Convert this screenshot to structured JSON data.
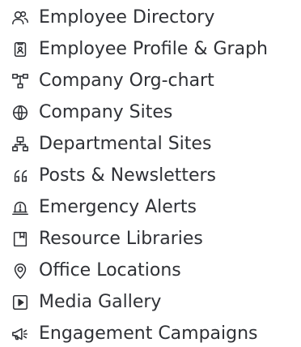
{
  "menu": {
    "items": [
      {
        "label": "Employee Directory",
        "icon": "people-icon"
      },
      {
        "label": "Employee Profile & Graph",
        "icon": "badge-icon"
      },
      {
        "label": "Company Org-chart",
        "icon": "org-chart-icon"
      },
      {
        "label": "Company Sites",
        "icon": "globe-icon"
      },
      {
        "label": "Departmental Sites",
        "icon": "network-icon"
      },
      {
        "label": "Posts & Newsletters",
        "icon": "quote-icon"
      },
      {
        "label": "Emergency Alerts",
        "icon": "alert-icon"
      },
      {
        "label": "Resource Libraries",
        "icon": "book-icon"
      },
      {
        "label": "Office Locations",
        "icon": "location-pin-icon"
      },
      {
        "label": "Media Gallery",
        "icon": "play-icon"
      },
      {
        "label": "Engagement Campaigns",
        "icon": "megaphone-icon"
      }
    ]
  }
}
